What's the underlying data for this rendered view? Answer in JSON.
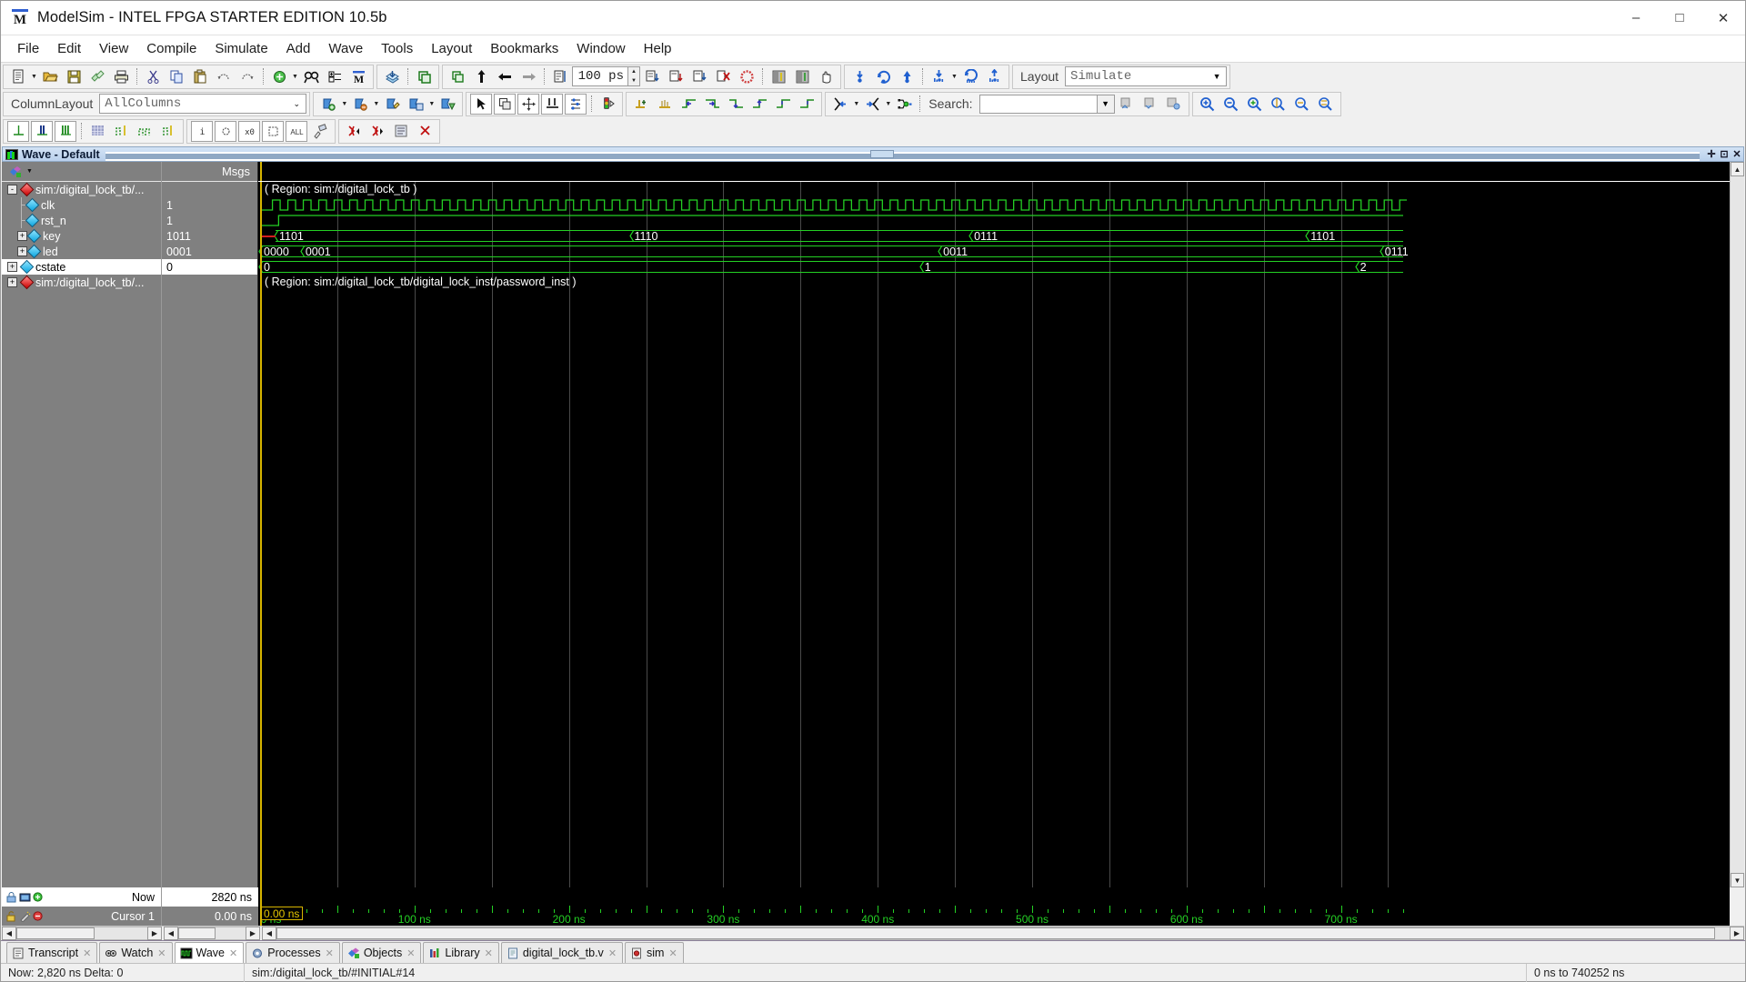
{
  "window": {
    "title": "ModelSim - INTEL FPGA STARTER EDITION 10.5b",
    "app_icon": "modelsim-m-icon",
    "minimize": "–",
    "maximize": "□",
    "close": "✕"
  },
  "menu": {
    "items": [
      {
        "label": "File"
      },
      {
        "label": "Edit"
      },
      {
        "label": "View"
      },
      {
        "label": "Compile"
      },
      {
        "label": "Simulate"
      },
      {
        "label": "Add"
      },
      {
        "label": "Wave"
      },
      {
        "label": "Tools"
      },
      {
        "label": "Layout"
      },
      {
        "label": "Bookmarks"
      },
      {
        "label": "Window"
      },
      {
        "label": "Help"
      }
    ]
  },
  "toolbar": {
    "run_length": {
      "value": "100 ps",
      "label": "run-length"
    },
    "layout": {
      "label": "Layout",
      "value": "Simulate"
    },
    "column_layout": {
      "label": "ColumnLayout",
      "value": "AllColumns"
    },
    "search": {
      "label": "Search:",
      "value": "",
      "placeholder": ""
    }
  },
  "wave": {
    "title": "Wave - Default",
    "column_headers": {
      "name": "",
      "msgs": "Msgs"
    },
    "signals": [
      {
        "name": "sim:/digital_lock_tb/...",
        "value": "",
        "depth": 0,
        "expander": "-",
        "icon": "red-diamond-icon",
        "selected": false
      },
      {
        "name": "clk",
        "value": "1",
        "depth": 1,
        "expander": "",
        "icon": "blue-diamond-icon",
        "selected": false
      },
      {
        "name": "rst_n",
        "value": "1",
        "depth": 1,
        "expander": "",
        "icon": "blue-diamond-icon",
        "selected": false
      },
      {
        "name": "key",
        "value": "1011",
        "depth": 1,
        "expander": "+",
        "icon": "blue-diamond-icon",
        "selected": false
      },
      {
        "name": "led",
        "value": "0001",
        "depth": 1,
        "expander": "+",
        "icon": "blue-diamond-icon",
        "selected": false
      },
      {
        "name": "cstate",
        "value": "0",
        "depth": 0,
        "expander": "+",
        "icon": "blue-diamond-icon",
        "selected": true
      },
      {
        "name": "sim:/digital_lock_tb/...",
        "value": "",
        "depth": 0,
        "expander": "+",
        "icon": "red-diamond-icon",
        "selected": false
      }
    ],
    "regions": [
      {
        "label": "( Region: sim:/digital_lock_tb )",
        "row": 0
      },
      {
        "label": "( Region: sim:/digital_lock_tb/digital_lock_inst/password_inst )",
        "row": 6
      }
    ],
    "key_transitions": [
      {
        "value": "1101",
        "time_ns": 10
      },
      {
        "value": "1110",
        "time_ns": 240
      },
      {
        "value": "0111",
        "time_ns": 460
      },
      {
        "value": "1101",
        "time_ns": 678
      }
    ],
    "led_transitions": [
      {
        "value": "0000",
        "time_ns": 0
      },
      {
        "value": "0001",
        "time_ns": 27
      },
      {
        "value": "0011",
        "time_ns": 440
      },
      {
        "value": "0111",
        "time_ns": 726
      }
    ],
    "cstate_transitions": [
      {
        "value": "0",
        "time_ns": 0
      },
      {
        "value": "1",
        "time_ns": 428
      },
      {
        "value": "2",
        "time_ns": 710
      }
    ],
    "clock_period_ns": 10,
    "reset_release_ns": 12,
    "cursor": {
      "label": "Cursor 1",
      "value": "0.00 ns",
      "box_label": "0.00 ns"
    },
    "now": {
      "label": "Now",
      "value": "2820 ns"
    },
    "timeline": {
      "labels": [
        "0 ns",
        "100 ns",
        "200 ns",
        "300 ns",
        "400 ns",
        "500 ns",
        "600 ns",
        "700 ns"
      ],
      "values_ns": [
        0,
        100,
        200,
        300,
        400,
        500,
        600,
        700
      ],
      "minor_tick_ns": 10,
      "view_start_ns": 0,
      "view_end_ns": 740.252
    }
  },
  "tabs": [
    {
      "label": "Transcript",
      "icon": "transcript-icon",
      "active": false
    },
    {
      "label": "Watch",
      "icon": "watch-icon",
      "active": false
    },
    {
      "label": "Wave",
      "icon": "wave-icon",
      "active": true
    },
    {
      "label": "Processes",
      "icon": "processes-icon",
      "active": false
    },
    {
      "label": "Objects",
      "icon": "objects-icon",
      "active": false
    },
    {
      "label": "Library",
      "icon": "library-icon",
      "active": false
    },
    {
      "label": "digital_lock_tb.v",
      "icon": "file-icon",
      "active": false
    },
    {
      "label": "sim",
      "icon": "sim-icon",
      "active": false
    }
  ],
  "status": {
    "now": "Now: 2,820 ns  Delta: 0",
    "context": "sim:/digital_lock_tb/#INITIAL#14",
    "range": "0 ns to 740252 ns"
  }
}
